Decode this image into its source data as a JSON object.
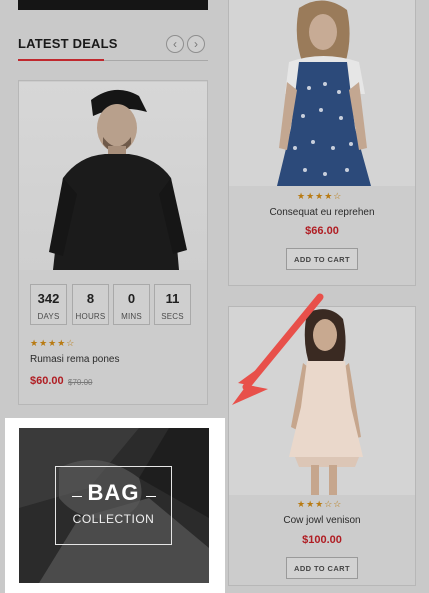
{
  "deals": {
    "title": "LATEST DEALS",
    "prev_icon": "chevron-left-icon",
    "next_icon": "chevron-right-icon",
    "prev_glyph": "‹",
    "next_glyph": "›",
    "countdown": [
      {
        "value": "342",
        "label": "DAYS"
      },
      {
        "value": "8",
        "label": "HOURS"
      },
      {
        "value": "0",
        "label": "MINS"
      },
      {
        "value": "11",
        "label": "SECS"
      }
    ],
    "product": {
      "rating": 4,
      "stars_text": "★★★★☆",
      "name": "Rumasi rema pones",
      "price": "$60.00",
      "old_price": "$70.00"
    }
  },
  "products": [
    {
      "rating": 4,
      "stars_text": "★★★★☆",
      "name": "Consequat eu reprehen",
      "price": "$66.00",
      "cart_label": "ADD TO CART"
    },
    {
      "rating": 3,
      "stars_text": "★★★☆☆",
      "name": "Cow jowl venison",
      "price": "$100.00",
      "cart_label": "ADD TO CART"
    }
  ],
  "banner": {
    "title": "BAG",
    "subtitle": "COLLECTION"
  },
  "colors": {
    "accent": "#c0282e",
    "price": "#b01d23",
    "arrow": "#e8504a"
  }
}
